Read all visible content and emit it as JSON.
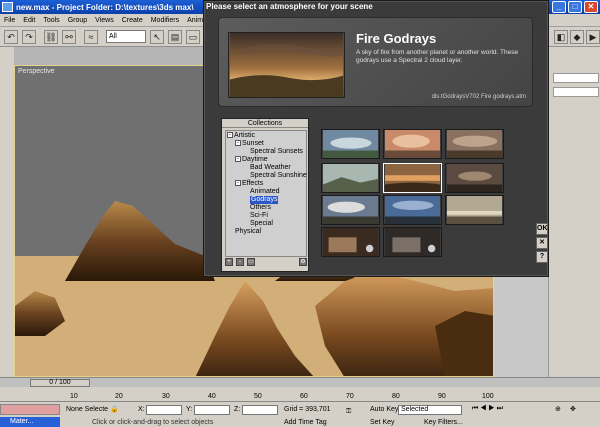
{
  "window": {
    "title": "new.max   - Project Folder: D:\\textures\\3ds max\\"
  },
  "menu": [
    "File",
    "Edit",
    "Tools",
    "Group",
    "Views",
    "Create",
    "Modifiers",
    "Animation"
  ],
  "toolbar": {
    "selection_filter": "All"
  },
  "viewport": {
    "label": "Perspective"
  },
  "timeline": {
    "slider": "0 / 100",
    "ticks": [
      "10",
      "20",
      "30",
      "40",
      "50",
      "60",
      "70",
      "80",
      "90",
      "100"
    ]
  },
  "status": {
    "selection": "None Selecte",
    "x_label": "X:",
    "y_label": "Y:",
    "z_label": "Z:",
    "grid": "Grid = 393,701",
    "auto_key": "Auto Key",
    "selected": "Selected",
    "set_key": "Set Key",
    "key_filters": "Key Filters...",
    "hint": "Click or click-and-drag to select objects",
    "add_time_tag": "Add Time Tag",
    "taskbar": "Mater..."
  },
  "dialog": {
    "title": "Please select an atmosphere for your scene",
    "preset_title": "Fire Godrays",
    "preset_desc": "A sky of fire from another planet or another world. These godrays use a Spectral 2 cloud layer.",
    "preset_file": "dis.tGodraysV702 Fire godrays.atm",
    "collections_header": "Collections",
    "tree": [
      {
        "label": "Artistic",
        "level": 0,
        "toggle": "-",
        "selected": false
      },
      {
        "label": "Sunset",
        "level": 1,
        "toggle": "-",
        "selected": false
      },
      {
        "label": "Spectral Sunsets",
        "level": 2,
        "toggle": "",
        "selected": false
      },
      {
        "label": "Daytime",
        "level": 1,
        "toggle": "-",
        "selected": false
      },
      {
        "label": "Bad Weather",
        "level": 2,
        "toggle": "",
        "selected": false
      },
      {
        "label": "Spectral Sunshine",
        "level": 2,
        "toggle": "",
        "selected": false
      },
      {
        "label": "Effects",
        "level": 1,
        "toggle": "-",
        "selected": false
      },
      {
        "label": "Animated",
        "level": 2,
        "toggle": "",
        "selected": false
      },
      {
        "label": "Godrays",
        "level": 2,
        "toggle": "",
        "selected": true
      },
      {
        "label": "Others",
        "level": 2,
        "toggle": "",
        "selected": false
      },
      {
        "label": "Sci-Fi",
        "level": 2,
        "toggle": "",
        "selected": false
      },
      {
        "label": "Special",
        "level": 2,
        "toggle": "",
        "selected": false
      },
      {
        "label": "Physical",
        "level": 0,
        "toggle": "",
        "selected": false
      }
    ],
    "buttons": {
      "ok": "OK",
      "close": "✕",
      "help": "?"
    }
  },
  "colors": {
    "dialog_bg": "#3b3b3b",
    "selection_blue": "#2a56c8",
    "title_blue": "#1d5fd6"
  }
}
